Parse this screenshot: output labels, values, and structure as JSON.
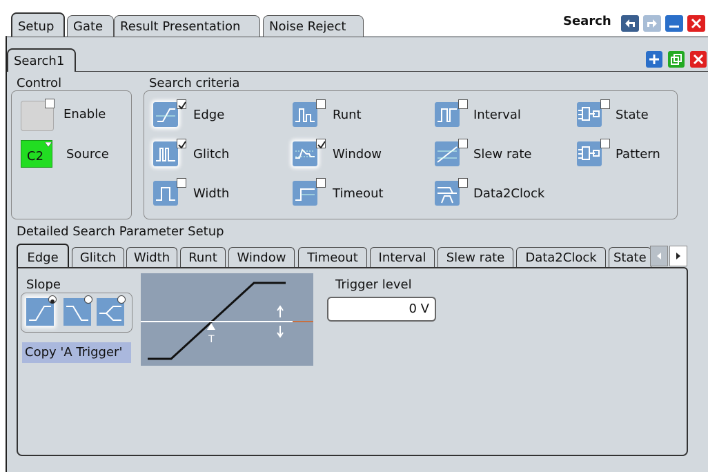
{
  "top_tabs": [
    "Setup",
    "Gate",
    "Result Presentation",
    "Noise Reject"
  ],
  "window": {
    "title": "Search",
    "icons": [
      "undo-icon",
      "redo-icon",
      "minimize-icon",
      "close-icon"
    ]
  },
  "sub_tab": {
    "label": "Search1",
    "icons": [
      "add-icon",
      "copy-icon",
      "delete-icon"
    ]
  },
  "control": {
    "label": "Control",
    "enable_label": "Enable",
    "source_label": "Source",
    "source_value": "C2",
    "source_color": "#22dd22"
  },
  "criteria": {
    "label": "Search criteria",
    "items": [
      {
        "label": "Edge",
        "checked": true
      },
      {
        "label": "Runt",
        "checked": false
      },
      {
        "label": "Interval",
        "checked": false
      },
      {
        "label": "State",
        "checked": false
      },
      {
        "label": "Glitch",
        "checked": true
      },
      {
        "label": "Window",
        "checked": true
      },
      {
        "label": "Slew rate",
        "checked": false
      },
      {
        "label": "Pattern",
        "checked": false
      },
      {
        "label": "Width",
        "checked": false
      },
      {
        "label": "Timeout",
        "checked": false
      },
      {
        "label": "Data2Clock",
        "checked": false
      }
    ]
  },
  "detail": {
    "label": "Detailed Search Parameter Setup",
    "tabs": [
      "Edge",
      "Glitch",
      "Width",
      "Runt",
      "Window",
      "Timeout",
      "Interval",
      "Slew rate",
      "Data2Clock",
      "State"
    ],
    "slope_label": "Slope",
    "slope_selected": "rising",
    "copy_button": "Copy 'A Trigger'",
    "trigger_level_label": "Trigger level",
    "trigger_level_value": "0 V",
    "diagram_marker": "T"
  },
  "colors": {
    "panel": "#d3d9de",
    "icon_blue": "#6f9ccd",
    "diagram_bg": "#8f9fb3",
    "accent_red": "#e02020",
    "accent_green": "#22aa22",
    "accent_blue": "#2a6fc9"
  }
}
